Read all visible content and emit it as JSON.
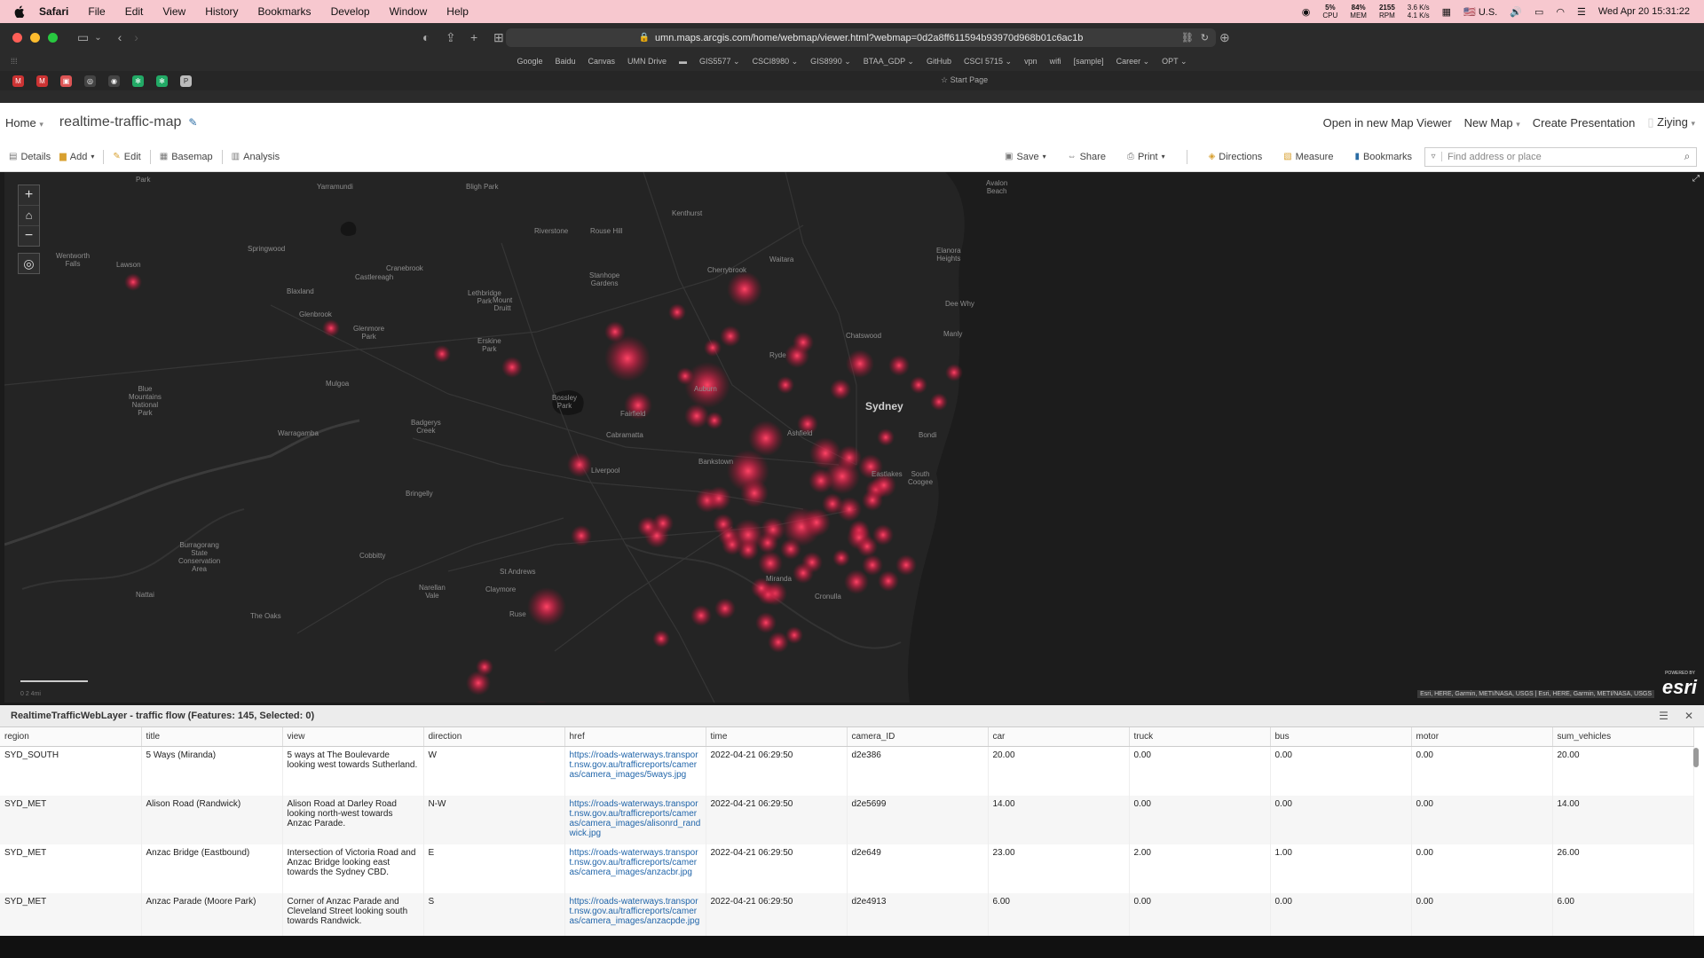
{
  "menubar": {
    "app": "Safari",
    "items": [
      "File",
      "Edit",
      "View",
      "History",
      "Bookmarks",
      "Develop",
      "Window",
      "Help"
    ],
    "status": {
      "cpu": "5%",
      "cpu_label": "CPU",
      "mem": "84%",
      "mem_label": "MEM",
      "rpm": "2155",
      "rpm_label": "RPM",
      "net_up": "3.6 K/s",
      "net_down": "4.1 K/s",
      "lang": "U.S.",
      "datetime": "Wed Apr 20  15:31:22"
    }
  },
  "browser": {
    "url": "umn.maps.arcgis.com/home/webmap/viewer.html?webmap=0d2a8ff611594b93970d968b01c6ac1b",
    "favorites": [
      "Google",
      "Baidu",
      "Canvas",
      "UMN Drive",
      "GIS5577 ⌄",
      "CSCI8980 ⌄",
      "GIS8990 ⌄",
      "BTAA_GDP ⌄",
      "GitHub",
      "CSCI 5715 ⌄",
      "vpn",
      "wifi",
      "[sample]",
      "Career ⌄",
      "OPT ⌄"
    ],
    "start_page": "Start Page"
  },
  "header": {
    "home": "Home",
    "map_title": "realtime-traffic-map",
    "open_map_viewer": "Open in new Map Viewer",
    "new_map": "New Map",
    "create_presentation": "Create Presentation",
    "user": "Ziying"
  },
  "toolbar": {
    "details": "Details",
    "add": "Add",
    "edit": "Edit",
    "basemap": "Basemap",
    "analysis": "Analysis",
    "save": "Save",
    "share": "Share",
    "print": "Print",
    "directions": "Directions",
    "measure": "Measure",
    "bookmarks": "Bookmarks",
    "search_placeholder": "Find address or place"
  },
  "map": {
    "places": [
      {
        "name": "Yarramundi",
        "big": false
      },
      {
        "name": "Bligh Park",
        "big": false
      },
      {
        "name": "Kenthurst",
        "big": false
      },
      {
        "name": "Riverstone",
        "big": false
      },
      {
        "name": "Rouse Hill",
        "big": false
      },
      {
        "name": "Springwood",
        "big": false
      },
      {
        "name": "Wentworth\nFalls",
        "big": false
      },
      {
        "name": "Lawson",
        "big": false
      },
      {
        "name": "Cranebrook",
        "big": false
      },
      {
        "name": "Castlereagh",
        "big": false
      },
      {
        "name": "Stanhope\nGardens",
        "big": false
      },
      {
        "name": "Cherrybrook",
        "big": false
      },
      {
        "name": "Waitara",
        "big": false
      },
      {
        "name": "Elanora\nHeights",
        "big": false
      },
      {
        "name": "Lethbridge\nPark",
        "big": false
      },
      {
        "name": "Blaxland",
        "big": false
      },
      {
        "name": "Glenbrook",
        "big": false
      },
      {
        "name": "Mount\nDruitt",
        "big": false
      },
      {
        "name": "Glenmore\nPark",
        "big": false
      },
      {
        "name": "Dee Why",
        "big": false
      },
      {
        "name": "Manly",
        "big": false
      },
      {
        "name": "Chatswood",
        "big": false
      },
      {
        "name": "Ryde",
        "big": false
      },
      {
        "name": "Erskine\nPark",
        "big": false
      },
      {
        "name": "Mulgoa",
        "big": false
      },
      {
        "name": "Auburn",
        "big": false
      },
      {
        "name": "Bossley\nPark",
        "big": false
      },
      {
        "name": "Sydney",
        "big": true
      },
      {
        "name": "Fairfield",
        "big": false
      },
      {
        "name": "Badgerys\nCreek",
        "big": false
      },
      {
        "name": "Warragamba",
        "big": false
      },
      {
        "name": "Ashfield",
        "big": false
      },
      {
        "name": "Cabramatta",
        "big": false
      },
      {
        "name": "Bondi",
        "big": false
      },
      {
        "name": "Bankstown",
        "big": false
      },
      {
        "name": "Liverpool",
        "big": false
      },
      {
        "name": "Eastlakes",
        "big": false
      },
      {
        "name": "South\nCoogee",
        "big": false
      },
      {
        "name": "Bringelly",
        "big": false
      },
      {
        "name": "Cobbitty",
        "big": false
      },
      {
        "name": "St Andrews",
        "big": false
      },
      {
        "name": "Narellan\nVale",
        "big": false
      },
      {
        "name": "Claymore",
        "big": false
      },
      {
        "name": "Miranda",
        "big": false
      },
      {
        "name": "Cronulla",
        "big": false
      },
      {
        "name": "Nattai",
        "big": false
      },
      {
        "name": "The Oaks",
        "big": false
      },
      {
        "name": "Ruse",
        "big": false
      },
      {
        "name": "Avalon\nBeach",
        "big": false
      },
      {
        "name": "Park",
        "big": false
      },
      {
        "name": "Blue\nMountains\nNational\nPark",
        "big": false
      },
      {
        "name": "Burragorang\nState\nConservation\nArea",
        "big": false
      }
    ],
    "scale_label": "0   2   4mi",
    "attribution": "Esri, HERE, Garmin, METI/NASA, USGS | Esri, HERE, Garmin, METI/NASA, USGS",
    "esri_logo": "esri",
    "esri_powered": "POWERED BY"
  },
  "table": {
    "title": "RealtimeTrafficWebLayer - traffic flow (Features: 145, Selected: 0)",
    "columns": [
      "region",
      "title",
      "view",
      "direction",
      "href",
      "time",
      "camera_ID",
      "car",
      "truck",
      "bus",
      "motor",
      "sum_vehicles"
    ],
    "rows": [
      [
        "SYD_SOUTH",
        "5 Ways (Miranda)",
        "5 ways at The Boulevarde looking west towards Sutherland.",
        "W",
        "https://roads-waterways.transport.nsw.gov.au/trafficreports/cameras/camera_images/5ways.jpg",
        "2022-04-21 06:29:50",
        "d2e386",
        "20.00",
        "0.00",
        "0.00",
        "0.00",
        "20.00"
      ],
      [
        "SYD_MET",
        "Alison Road (Randwick)",
        "Alison Road at Darley Road looking north-west towards Anzac Parade.",
        "N-W",
        "https://roads-waterways.transport.nsw.gov.au/trafficreports/cameras/camera_images/alisonrd_randwick.jpg",
        "2022-04-21 06:29:50",
        "d2e5699",
        "14.00",
        "0.00",
        "0.00",
        "0.00",
        "14.00"
      ],
      [
        "SYD_MET",
        "Anzac Bridge (Eastbound)",
        "Intersection of Victoria Road and Anzac Bridge looking east towards the Sydney CBD.",
        "E",
        "https://roads-waterways.transport.nsw.gov.au/trafficreports/cameras/camera_images/anzacbr.jpg",
        "2022-04-21 06:29:50",
        "d2e649",
        "23.00",
        "2.00",
        "1.00",
        "0.00",
        "26.00"
      ],
      [
        "SYD_MET",
        "Anzac Parade (Moore Park)",
        "Corner of Anzac Parade and Cleveland Street looking south towards Randwick.",
        "S",
        "https://roads-waterways.transport.nsw.gov.au/trafficreports/cameras/camera_images/anzacpde.jpg",
        "2022-04-21 06:29:50",
        "d2e4913",
        "6.00",
        "0.00",
        "0.00",
        "0.00",
        "6.00"
      ]
    ]
  },
  "colors": {
    "menubar_bg": "#f7c8cf",
    "map_bg": "#242424",
    "heat": "#ff3b5c",
    "link": "#2266aa"
  }
}
